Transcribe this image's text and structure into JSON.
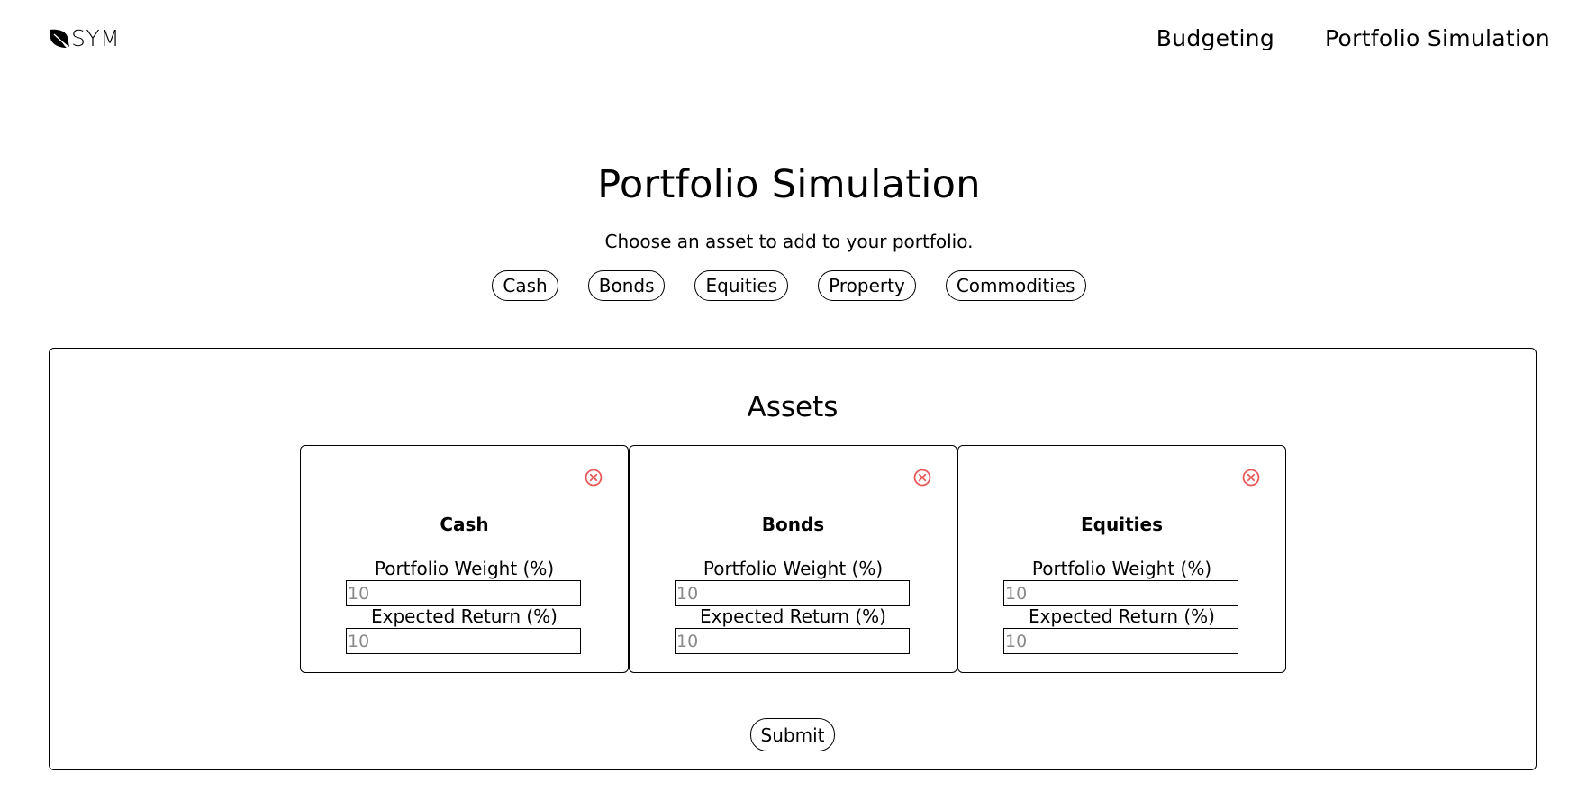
{
  "header": {
    "logo_text": "SYM",
    "nav": [
      {
        "label": "Budgeting"
      },
      {
        "label": "Portfolio Simulation"
      }
    ]
  },
  "main": {
    "title": "Portfolio Simulation",
    "subtitle": "Choose an asset to add to your portfolio.",
    "asset_options": [
      {
        "label": "Cash"
      },
      {
        "label": "Bonds"
      },
      {
        "label": "Equities"
      },
      {
        "label": "Property"
      },
      {
        "label": "Commodities"
      }
    ]
  },
  "assets_panel": {
    "title": "Assets",
    "weight_label": "Portfolio Weight (%)",
    "return_label": "Expected Return (%)",
    "cards": [
      {
        "name": "Cash",
        "weight_placeholder": "10",
        "return_placeholder": "10"
      },
      {
        "name": "Bonds",
        "weight_placeholder": "10",
        "return_placeholder": "10"
      },
      {
        "name": "Equities",
        "weight_placeholder": "10",
        "return_placeholder": "10"
      }
    ],
    "submit_label": "Submit"
  },
  "colors": {
    "remove_icon": "#e85a5a",
    "border": "#000000",
    "placeholder": "#8a8a8a"
  },
  "icons": {
    "logo": "leaf-icon",
    "remove": "close-circle-icon"
  }
}
